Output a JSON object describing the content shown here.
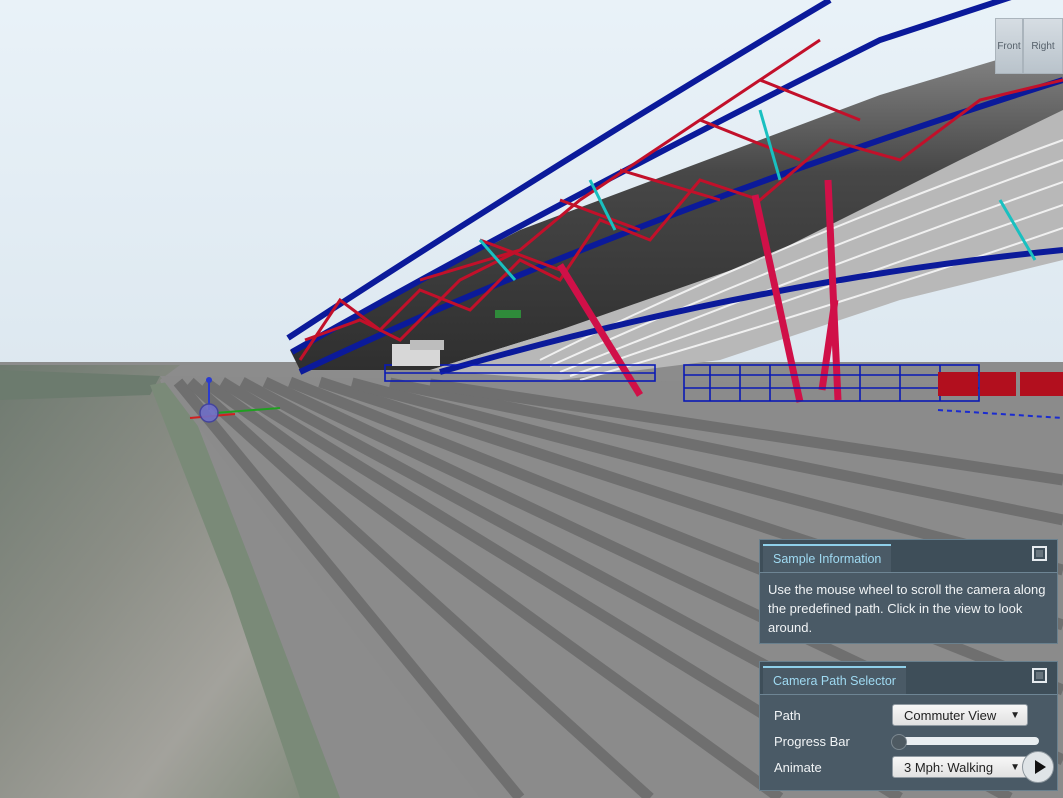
{
  "viewcube": {
    "front_label": "Front",
    "right_label": "Right"
  },
  "sample_panel": {
    "title": "Sample Information",
    "body": "Use the mouse wheel to scroll the camera along the predefined path. Click in the view to look around."
  },
  "camera_panel": {
    "title": "Camera Path Selector",
    "path_label": "Path",
    "path_value": "Commuter View",
    "progress_label": "Progress Bar",
    "progress_value": 0,
    "animate_label": "Animate",
    "animate_value": "3 Mph: Walking"
  }
}
